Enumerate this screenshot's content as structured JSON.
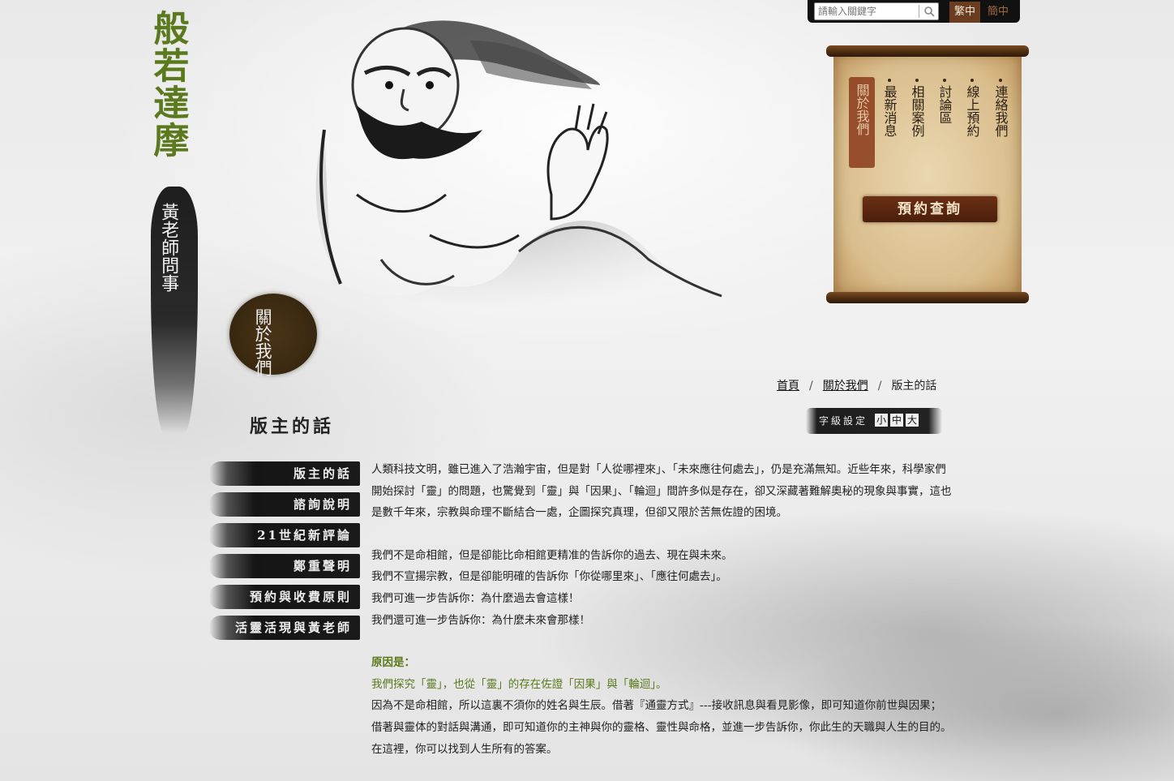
{
  "site": {
    "title": "般若達摩",
    "subtitle": "黃老師問事"
  },
  "topbar": {
    "search_placeholder": "請輸入關鍵字",
    "lang_traditional": "繁中",
    "lang_simplified": "簡中"
  },
  "scroll_nav": {
    "items": [
      {
        "label": "連絡我們",
        "active": false
      },
      {
        "label": "線上預約",
        "active": false
      },
      {
        "label": "討論區",
        "active": false
      },
      {
        "label": "相關案例",
        "active": false
      },
      {
        "label": "最新消息",
        "active": false
      },
      {
        "label": "關於我們",
        "active": true
      }
    ],
    "book_button": "預約查詢"
  },
  "section_seal": "關於我們",
  "breadcrumb": {
    "home": "首頁",
    "section": "關於我們",
    "current": "版主的話",
    "separator": "/"
  },
  "page_title": "版主的話",
  "font_size": {
    "label": "字級設定",
    "small": "小",
    "medium": "中",
    "large": "大"
  },
  "side_menu": [
    "版主的話",
    "諮詢說明",
    "21世紀新評論",
    "鄭重聲明",
    "預約與收費原則",
    "活靈活現與黃老師"
  ],
  "content": {
    "p1": "人類科技文明，雖已進入了浩瀚宇宙，但是對「人從哪裡來」、「未來應往何處去」，仍是充滿無知。近些年來，科學家們開始探討「靈」的問題，也驚覺到「靈」與「因果」、「輪迴」間許多似是存在，卻又深藏著難解奧秘的現象與事實，這也是數千年來，宗教與命理不斷結合一處，企圖探究真理，但卻又限於苦無佐證的困境。",
    "l1": "我們不是命相館，但是卻能比命相館更精准的告訴你的過去、現在與未來。",
    "l2": "我們不宣揚宗教，但是卻能明確的告訴你「你從哪里來」、「應往何處去」。",
    "l3": "我們可進一步告訴你：為什麼過去會這樣！",
    "l4": "我們還可進一步告訴你：為什麼未來會那樣！",
    "reason_title": "原因是：",
    "reason_text": "我們探究「靈」，也從「靈」的存在佐證「因果」與「輪迴」。",
    "p2": "因為不是命相館，所以這裏不須你的姓名與生辰。借著『通靈方式』---接收訊息與看見影像，即可知道你前世與因果；借著與靈体的對話與溝通，即可知道你的主神與你的靈格、靈性與命格，並進一步告訴你，你此生的天職與人生的目的。",
    "p3": "在這裡，你可以找到人生所有的答案。"
  },
  "colors": {
    "title_green": "#5b7a1e",
    "scroll_paper": "#e0c79a",
    "button_brown": "#5a2710",
    "accent_green": "#5a7a1c"
  }
}
